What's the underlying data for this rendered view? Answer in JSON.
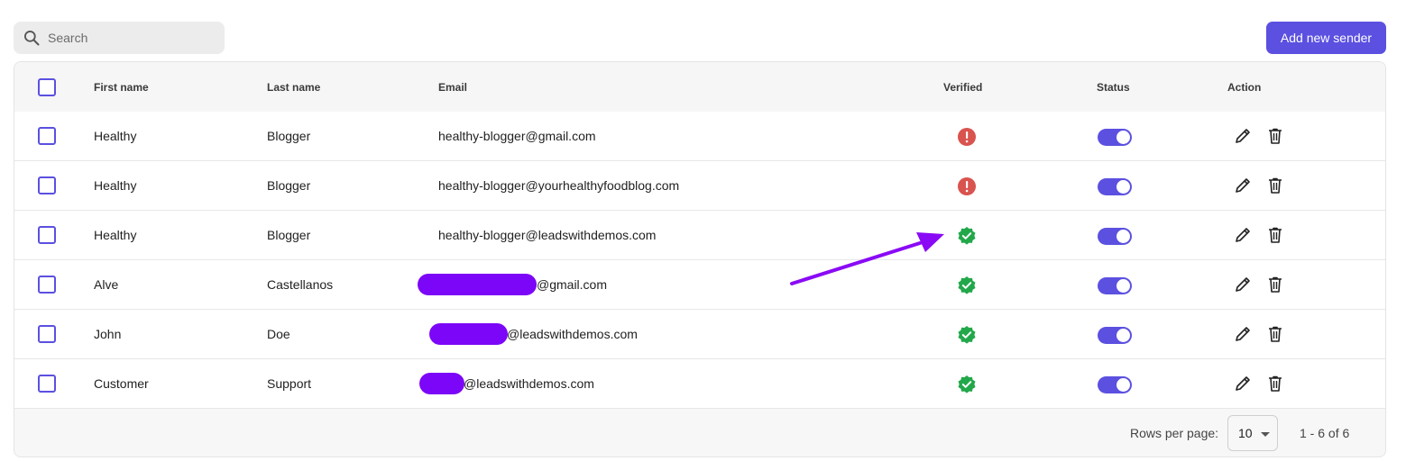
{
  "search": {
    "placeholder": "Search",
    "icon": "search-icon"
  },
  "toolbar": {
    "add_label": "Add new sender",
    "accent": "#5b50e0"
  },
  "table": {
    "headers": {
      "first_name": "First name",
      "last_name": "Last name",
      "email": "Email",
      "verified": "Verified",
      "status": "Status",
      "action": "Action"
    },
    "rows": [
      {
        "first": "Healthy",
        "last": "Blogger",
        "email_visible": "healthy-blogger@gmail.com",
        "redacted": false,
        "verified": "error",
        "status_on": true
      },
      {
        "first": "Healthy",
        "last": "Blogger",
        "email_visible": "healthy-blogger@yourhealthyfoodblog.com",
        "redacted": false,
        "verified": "error",
        "status_on": true
      },
      {
        "first": "Healthy",
        "last": "Blogger",
        "email_visible": "healthy-blogger@leadswithdemos.com",
        "redacted": false,
        "verified": "verified",
        "status_on": true
      },
      {
        "first": "Alve",
        "last": "Castellanos",
        "email_visible": "@gmail.com",
        "redacted": true,
        "verified": "verified",
        "status_on": true
      },
      {
        "first": "John",
        "last": "Doe",
        "email_visible": "@leadswithdemos.com",
        "redacted": true,
        "verified": "verified",
        "status_on": true
      },
      {
        "first": "Customer",
        "last": "Support",
        "email_visible": "@leadswithdemos.com",
        "redacted": true,
        "verified": "verified",
        "status_on": true
      }
    ]
  },
  "pagination": {
    "rows_per_page_label": "Rows per page:",
    "rows_per_page_value": "10",
    "range": "1 - 6 of 6"
  },
  "colors": {
    "error": "#d9534f",
    "verified": "#22a84a",
    "redaction": "#7c06f7",
    "annotation_arrow": "#8a0af5"
  }
}
